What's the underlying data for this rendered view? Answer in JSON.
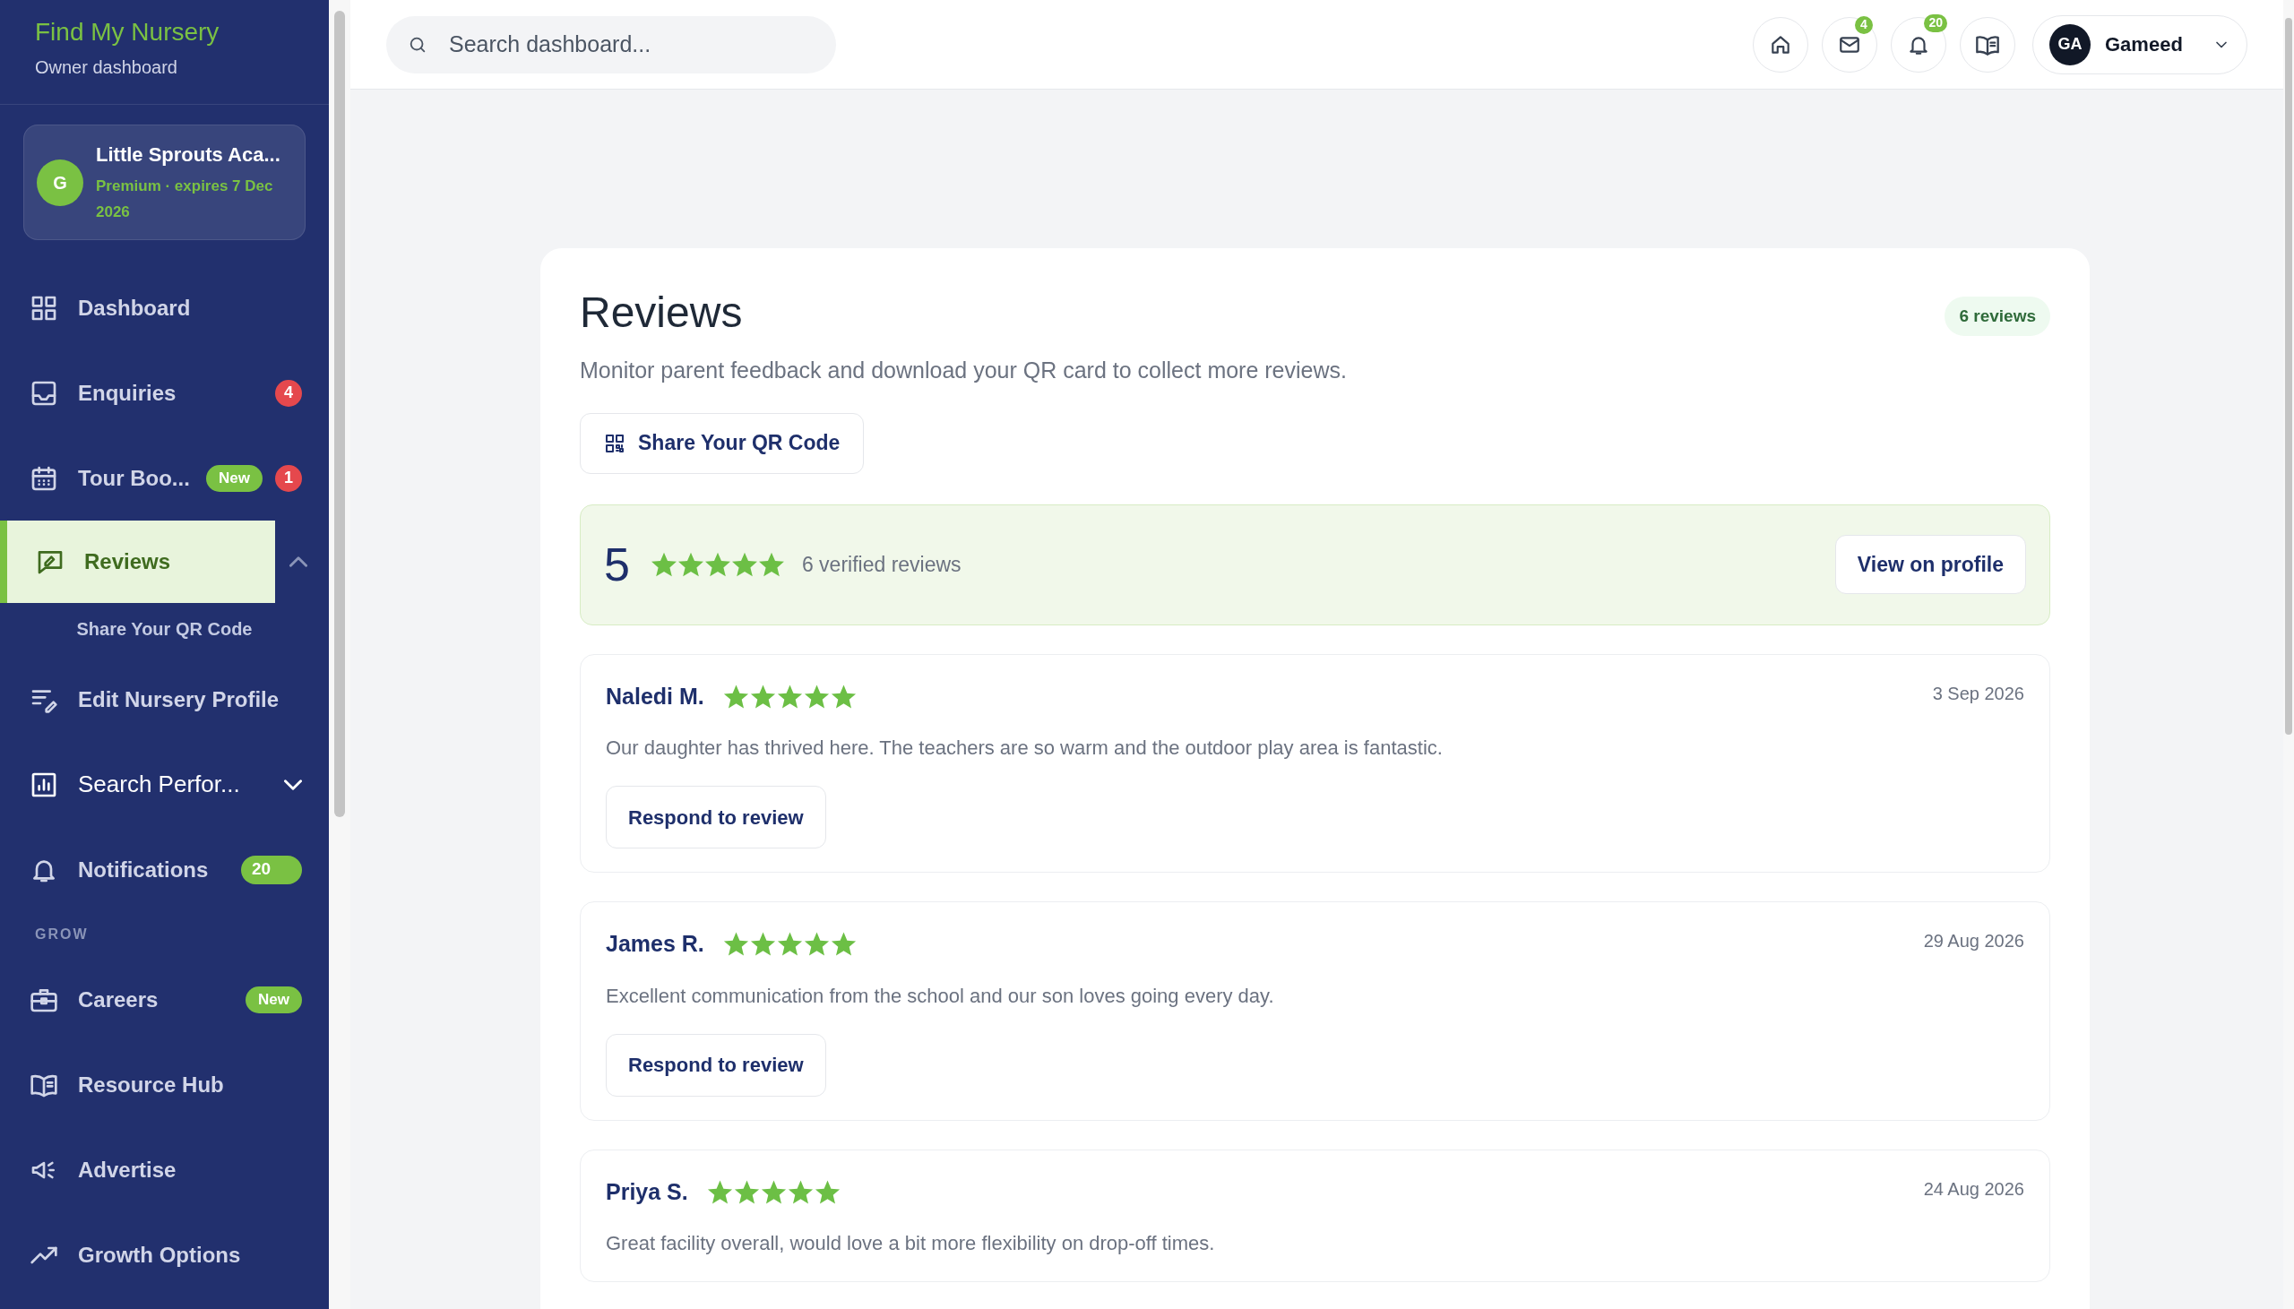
{
  "sidebar": {
    "brand": "Find My Nursery",
    "subtitle": "Owner dashboard",
    "account": {
      "initial": "G",
      "name": "Little Sprouts Aca...",
      "plan": "Premium · expires 7 Dec 2026"
    },
    "items": [
      {
        "kind": "item",
        "label": "Dashboard",
        "selected": false
      },
      {
        "kind": "item",
        "label": "Enquiries",
        "selected": false,
        "badges": [
          {
            "kind": "alert",
            "text": "4"
          }
        ]
      },
      {
        "kind": "item",
        "label": "Tour Boo...",
        "selected": false,
        "badges": [
          {
            "kind": "new",
            "text": "New"
          },
          {
            "kind": "alert",
            "text": "1"
          }
        ]
      },
      {
        "kind": "group",
        "label": "Reviews",
        "selected": true,
        "expanded": true,
        "children": [
          {
            "label": "Share Your QR Code"
          }
        ]
      },
      {
        "kind": "item",
        "label": "Edit Nursery Profile",
        "selected": false
      },
      {
        "kind": "group",
        "label": "Search Perfor...",
        "selected": false,
        "expanded": false
      },
      {
        "kind": "item",
        "label": "Notifications",
        "selected": false,
        "badges": [
          {
            "kind": "count",
            "text": "20"
          }
        ]
      },
      {
        "kind": "heading",
        "label": "GROW"
      },
      {
        "kind": "item",
        "label": "Careers",
        "selected": false,
        "badges": [
          {
            "kind": "new",
            "text": "New"
          }
        ]
      },
      {
        "kind": "item",
        "label": "Resource Hub",
        "selected": false
      },
      {
        "kind": "item",
        "label": "Advertise",
        "selected": false
      },
      {
        "kind": "item",
        "label": "Growth Options",
        "selected": false
      }
    ]
  },
  "topbar": {
    "search_placeholder": "Search dashboard...",
    "mail_badge": "4",
    "notification_badge": "20",
    "user": {
      "initials": "GA",
      "name": "Gameed"
    }
  },
  "page": {
    "title": "Reviews",
    "count": "6 reviews",
    "description": "Monitor parent feedback and download your QR card to collect more reviews.",
    "qr_button": "Share Your QR Code",
    "summary": {
      "score": "5",
      "stars": 5,
      "label": "6 verified reviews",
      "button": "View on profile"
    },
    "reviews": [
      {
        "author": "Naledi M.",
        "stars": 5,
        "date": "3 Sep 2026",
        "text": "Our daughter has thrived here. The teachers are so warm and the outdoor play area is fantastic.",
        "respond": "Respond to review"
      },
      {
        "author": "James R.",
        "stars": 5,
        "date": "29 Aug 2026",
        "text": "Excellent communication from the school and our son loves going every day.",
        "respond": "Respond to review"
      },
      {
        "author": "Priya S.",
        "stars": 5,
        "date": "24 Aug 2026",
        "text": "Great facility overall, would love a bit more flexibility on drop-off times."
      }
    ]
  }
}
